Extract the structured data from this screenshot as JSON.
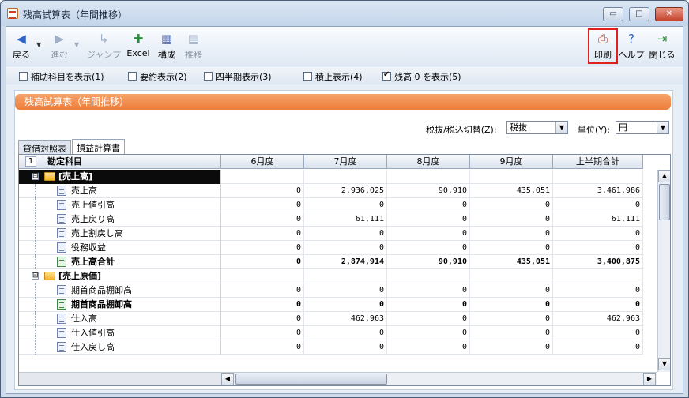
{
  "window": {
    "title": "残高試算表（年間推移）",
    "buttons": {
      "minimize": "▭",
      "maximize": "□",
      "close": "✕"
    }
  },
  "toolbar": {
    "back": "戻る",
    "forward": "進む",
    "jump": "ジャンプ",
    "excel": "Excel",
    "compose": "構成",
    "transition": "推移",
    "print": "印刷",
    "help": "ヘルプ",
    "close": "閉じる"
  },
  "options": [
    {
      "label": "補助科目を表示(1)",
      "checked": false
    },
    {
      "label": "要約表示(2)",
      "checked": false
    },
    {
      "label": "四半期表示(3)",
      "checked": false
    },
    {
      "label": "積上表示(4)",
      "checked": false
    },
    {
      "label": "残高 0 を表示(5)",
      "checked": true
    }
  ],
  "panel": {
    "banner": "残高試算表（年間推移）",
    "tax_label": "税抜/税込切替(Z):",
    "tax_value": "税抜",
    "unit_label": "単位(Y):",
    "unit_value": "円"
  },
  "tabs": [
    {
      "label": "貸借対照表",
      "active": false
    },
    {
      "label": "損益計算書",
      "active": true
    }
  ],
  "grid": {
    "level": "1",
    "account_header": "勘定科目",
    "columns": [
      "6月度",
      "7月度",
      "8月度",
      "9月度",
      "上半期合計"
    ],
    "rows": [
      {
        "type": "group",
        "expander": "⊟",
        "label": "[売上高]",
        "selected": true,
        "values": [
          "",
          "",
          "",
          "",
          ""
        ]
      },
      {
        "type": "item",
        "label": "売上高",
        "values": [
          "0",
          "2,936,025",
          "90,910",
          "435,051",
          "3,461,986"
        ]
      },
      {
        "type": "item",
        "label": "売上値引高",
        "values": [
          "0",
          "0",
          "0",
          "0",
          "0"
        ]
      },
      {
        "type": "item",
        "label": "売上戻り高",
        "values": [
          "0",
          "61,111",
          "0",
          "0",
          "61,111"
        ]
      },
      {
        "type": "item",
        "label": "売上割戻し高",
        "values": [
          "0",
          "0",
          "0",
          "0",
          "0"
        ]
      },
      {
        "type": "item",
        "label": "役務収益",
        "values": [
          "0",
          "0",
          "0",
          "0",
          "0"
        ]
      },
      {
        "type": "sum",
        "label": "売上高合計",
        "values": [
          "0",
          "2,874,914",
          "90,910",
          "435,051",
          "3,400,875"
        ]
      },
      {
        "type": "group",
        "expander": "⊟",
        "label": "[売上原価]",
        "selected": false,
        "values": [
          "",
          "",
          "",
          "",
          ""
        ]
      },
      {
        "type": "item",
        "label": "期首商品棚卸高",
        "values": [
          "0",
          "0",
          "0",
          "0",
          "0"
        ]
      },
      {
        "type": "sum",
        "label": "期首商品棚卸高",
        "values": [
          "0",
          "0",
          "0",
          "0",
          "0"
        ]
      },
      {
        "type": "item",
        "label": "仕入高",
        "values": [
          "0",
          "462,963",
          "0",
          "0",
          "462,963"
        ]
      },
      {
        "type": "item",
        "label": "仕入値引高",
        "values": [
          "0",
          "0",
          "0",
          "0",
          "0"
        ]
      },
      {
        "type": "item",
        "label": "仕入戻し高",
        "values": [
          "0",
          "0",
          "0",
          "0",
          "0"
        ]
      }
    ]
  },
  "colors": {
    "banner": "#ed7d3a",
    "highlight": "#e0201c",
    "window_frame": "#cfdbe9"
  }
}
